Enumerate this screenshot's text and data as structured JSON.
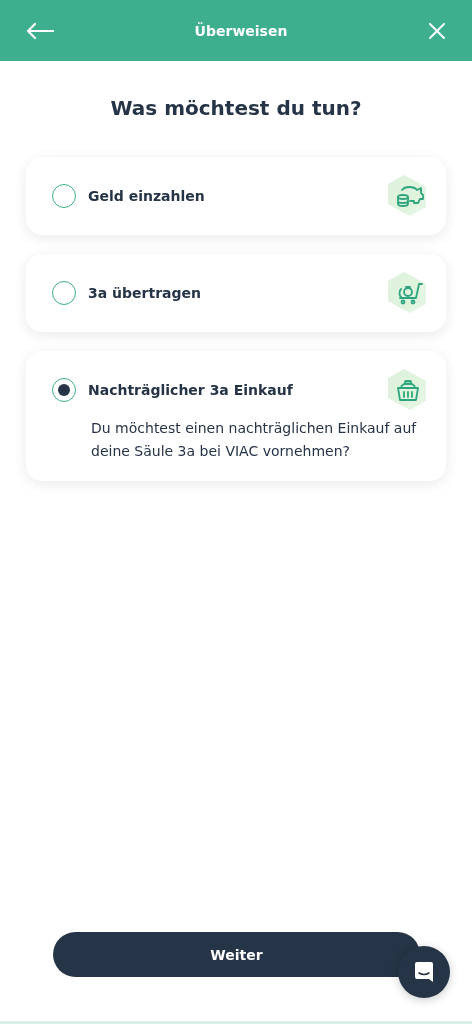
{
  "header": {
    "title": "Überweisen"
  },
  "heading": "Was möchtest du tun?",
  "options": [
    {
      "label": "Geld einzahlen",
      "selected": false,
      "kind": "piggy"
    },
    {
      "label": "3a übertragen",
      "selected": false,
      "kind": "cart"
    },
    {
      "label": "Nachträglicher 3a Einkauf",
      "selected": true,
      "kind": "basket",
      "description": "Du möchtest einen nachträglichen Einkauf auf deine Säule 3a bei VIAC vornehmen?"
    }
  ],
  "primary_button": "Weiter"
}
